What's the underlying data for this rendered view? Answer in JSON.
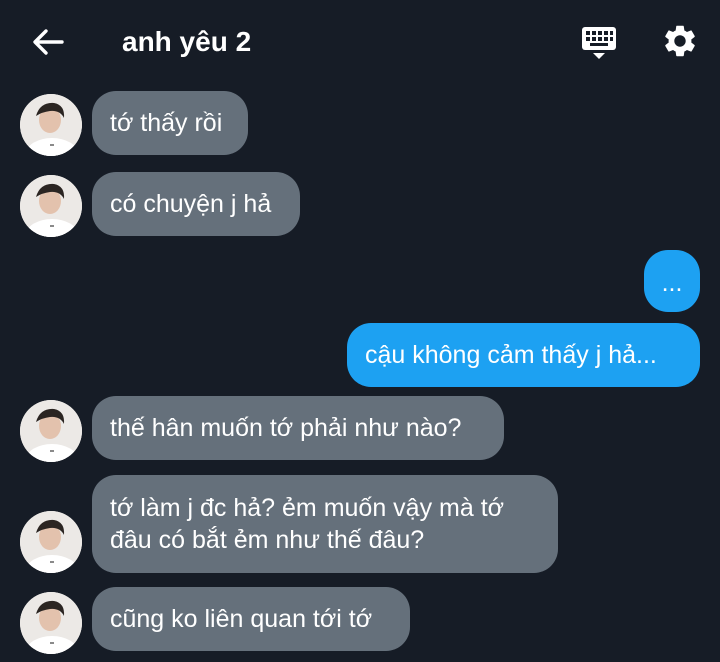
{
  "header": {
    "title": "anh yêu 2",
    "back_icon": "arrow-left-icon",
    "keyboard_icon": "keyboard-icon",
    "settings_icon": "gear-icon"
  },
  "colors": {
    "background": "#161c26",
    "incoming_bubble": "#65707b",
    "outgoing_bubble": "#1da1f2"
  },
  "messages": [
    {
      "sender": "them",
      "text": "tớ thấy rồi"
    },
    {
      "sender": "them",
      "text": "có chuyện j hả"
    },
    {
      "sender": "me",
      "text": "..."
    },
    {
      "sender": "me",
      "text": "cậu không cảm thấy j hả..."
    },
    {
      "sender": "them",
      "text": "thế hân muốn tớ phải như nào?"
    },
    {
      "sender": "them",
      "lines": [
        "tớ làm j đc hả? ẻm muốn vậy mà tớ",
        "đâu có bắt ẻm như thế đâu?"
      ]
    },
    {
      "sender": "them",
      "text": "cũng ko liên quan tới tớ"
    }
  ]
}
